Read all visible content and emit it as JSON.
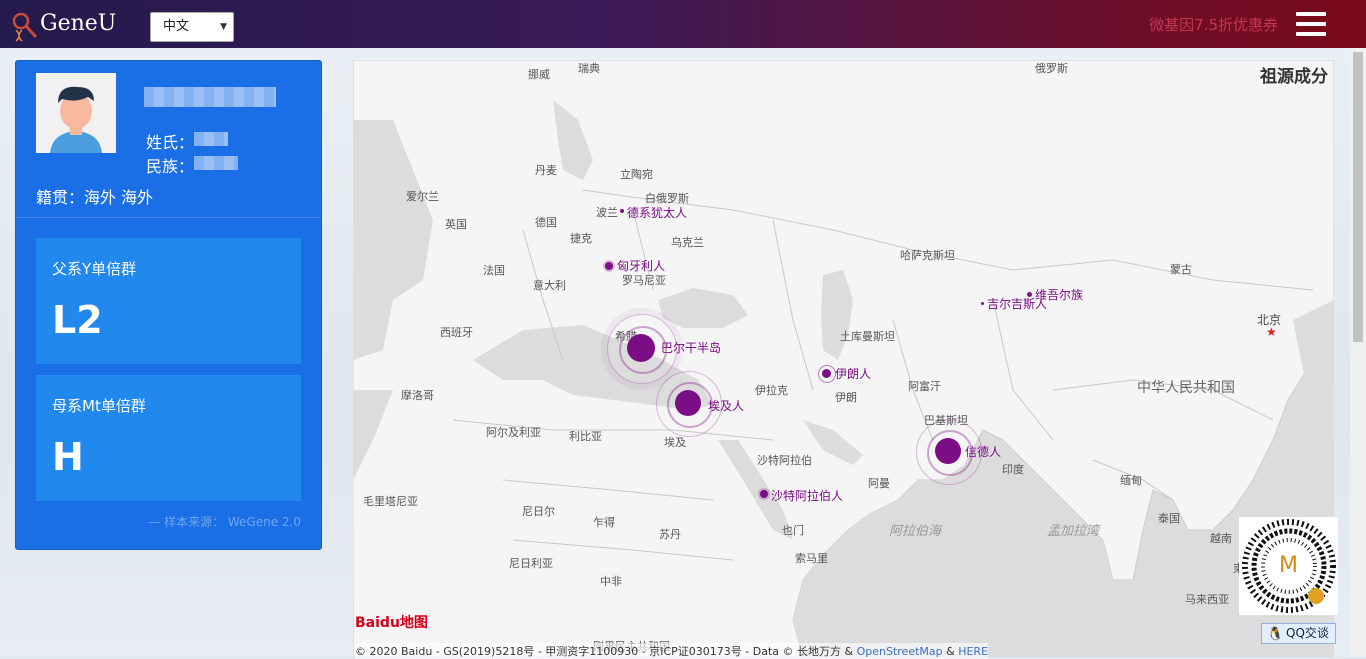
{
  "header": {
    "brand": "GeneU",
    "language": "中文",
    "promo": "微基因7.5折优惠券"
  },
  "profile": {
    "surname_label": "姓氏：",
    "ethnicity_label": "民族：",
    "origin": "籍贯：海外 海外",
    "paternal_title": "父系Y单倍群",
    "paternal_value": "L2",
    "maternal_title": "母系Mt单倍群",
    "maternal_value": "H",
    "source": "— 样本来源： WeGene 2.0"
  },
  "map": {
    "title": "祖源成分",
    "populations": [
      {
        "name": "巴尔干半岛",
        "size": "large"
      },
      {
        "name": "埃及人",
        "size": "large"
      },
      {
        "name": "信德人",
        "size": "large"
      },
      {
        "name": "伊朗人",
        "size": "medium"
      },
      {
        "name": "德系犹太人",
        "size": "small"
      },
      {
        "name": "匈牙利人",
        "size": "small"
      },
      {
        "name": "吉尔吉斯人",
        "size": "small"
      },
      {
        "name": "维吾尔族",
        "size": "small"
      },
      {
        "name": "沙特阿拉伯人",
        "size": "small"
      }
    ],
    "place_labels": [
      "挪威",
      "瑞典",
      "俄罗斯",
      "丹麦",
      "立陶宛",
      "爱尔兰",
      "白俄罗斯",
      "英国",
      "德国",
      "波兰",
      "捷克",
      "乌克兰",
      "哈萨克斯坦",
      "法国",
      "意大利",
      "罗马尼亚",
      "蒙古",
      "西班牙",
      "希腊",
      "土库曼斯坦",
      "北京",
      "摩洛哥",
      "伊拉克",
      "阿富汗",
      "伊朗",
      "阿尔及利亚",
      "利比亚",
      "埃及",
      "巴基斯坦",
      "沙特阿拉伯",
      "印度",
      "毛里塔尼亚",
      "阿曼",
      "缅甸",
      "尼日尔",
      "乍得",
      "苏丹",
      "也门",
      "泰国",
      "越南",
      "尼日利亚",
      "索马里",
      "中非",
      "马来西亚",
      "柬埔寨",
      "刚果民主共和国"
    ],
    "country_big": "中华人民共和国",
    "seas": [
      "阿拉伯海",
      "孟加拉湾"
    ],
    "baidu_logo": "Baidu地图",
    "copyright": "© 2020 Baidu - GS(2019)5218号 - 甲测资字1100930 - 京ICP证030173号 - Data © 长地万方 & ",
    "osm_link": "OpenStreetMap",
    "amp": " & ",
    "here_link": "HERE",
    "qq_label": "QQ交谈",
    "qr_letter": "M"
  },
  "colors": {
    "card": "#1a6fe6",
    "box": "#2188ee",
    "population": "#7b0d85",
    "promo": "#c2364e"
  }
}
